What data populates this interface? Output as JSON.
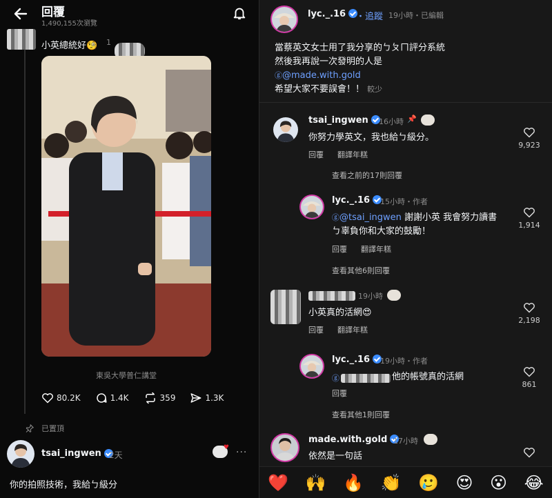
{
  "left": {
    "title": "回覆",
    "views": "1,490,155次瀏覽",
    "parent_post": {
      "text": "小英總統好🧐",
      "count": "1"
    },
    "photo_caption": "東吳大學普仁講堂",
    "actions": {
      "likes": "80.2K",
      "comments": "1.4K",
      "reposts": "359",
      "shares": "1.3K"
    },
    "pinned_label": "已置頂",
    "reply": {
      "username": "tsai_ingwen",
      "time": "2天",
      "more": "···",
      "text": "你的拍照技術，我給ㄅ級分"
    }
  },
  "right": {
    "post": {
      "username": "lyc._.16",
      "follow_label": "追蹤",
      "meta": "19小時・已編輯",
      "lines": [
        "當蔡英文女士用了我分享的ㄅㄆㄇ評分系統",
        "然後我再說一次發明的人是"
      ],
      "mention": "@made.with.gold",
      "last_line": "希望大家不要誤會！！",
      "less_label": "較少"
    },
    "comments": [
      {
        "username": "tsai_ingwen",
        "meta": "16小時",
        "text": "你努力學英文，我也給ㄅ級分。",
        "reply_label": "回覆",
        "translate_label": "翻譯年糕",
        "likes": "9,923"
      },
      {
        "username": "lyc._.16",
        "meta": "15小時・作者",
        "mention": "@tsai_ingwen",
        "text_rest": " 謝謝小英 我會努力讀書",
        "text_line2": "ㄅ辜負你和大家的鼓勵！",
        "reply_label": "回覆",
        "translate_label": "翻譯年糕",
        "likes": "1,914"
      },
      {
        "meta": "19小時",
        "text": "小英真的活網😍",
        "reply_label": "回覆",
        "translate_label": "翻譯年糕",
        "likes": "2,198"
      },
      {
        "username": "lyc._.16",
        "meta": "19小時・作者",
        "text_rest": "他的帳號真的活網",
        "reply_label": "回覆",
        "likes": "861"
      },
      {
        "username": "made.with.gold",
        "meta": "17小時",
        "text": "依然是一句話"
      }
    ],
    "view_previous": "查看之前的17則回覆",
    "view_other_6": "查看其他6則回覆",
    "view_other_1": "查看其他1則回覆",
    "emojis": [
      "❤️",
      "🙌",
      "🔥",
      "👏",
      "🥲",
      "😍",
      "😮",
      "😂"
    ]
  }
}
